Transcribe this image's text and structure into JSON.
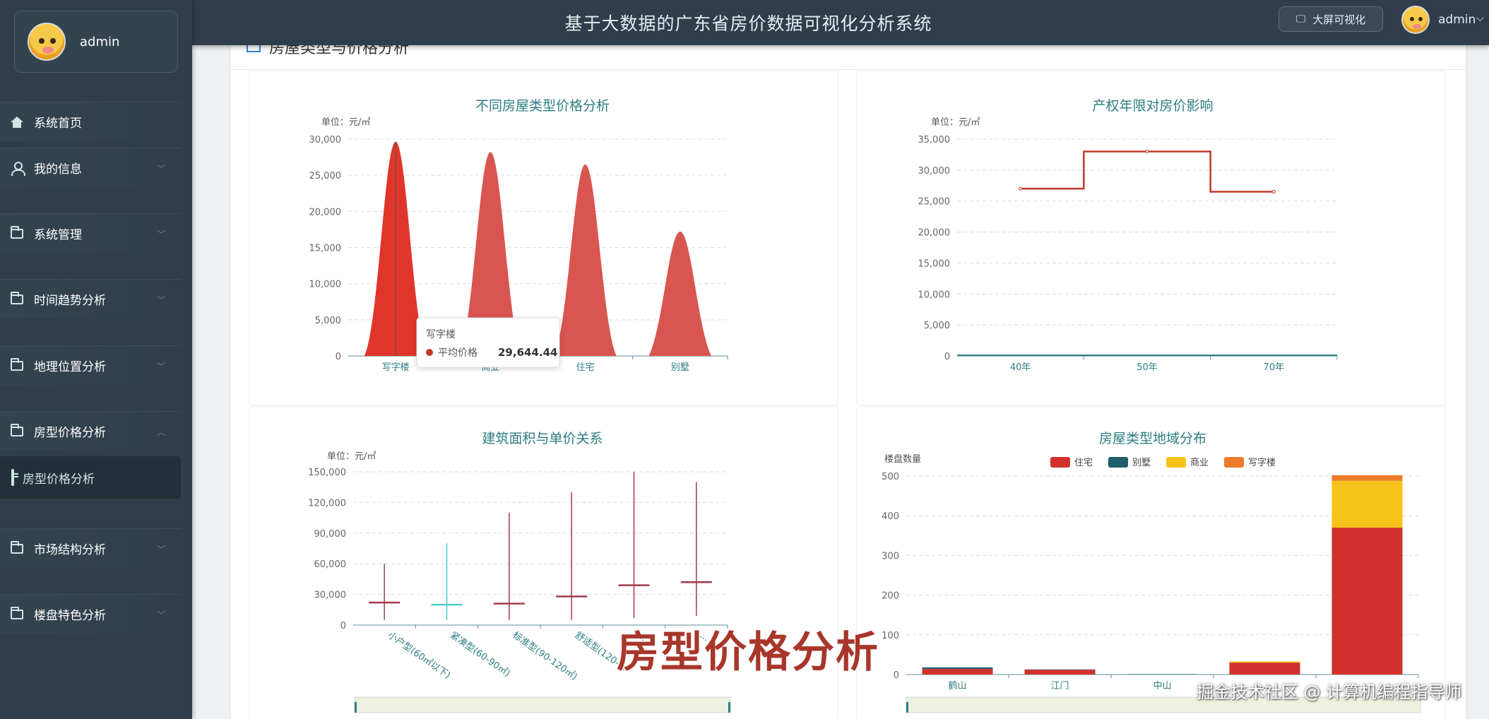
{
  "header": {
    "title": "基于大数据的广东省房价数据可视化分析系统",
    "bigscreen_label": "大屏可视化",
    "username": "admin"
  },
  "sidebar": {
    "username": "admin",
    "items": [
      {
        "label": "系统首页",
        "icon": "home-icon"
      },
      {
        "label": "我的信息",
        "icon": "user-icon"
      },
      {
        "label": "系统管理",
        "icon": "folder-icon"
      },
      {
        "label": "时间趋势分析",
        "icon": "folder-icon"
      },
      {
        "label": "地理位置分析",
        "icon": "folder-icon"
      },
      {
        "label": "房型价格分析",
        "icon": "folder-icon"
      },
      {
        "label": "市场结构分析",
        "icon": "folder-icon"
      },
      {
        "label": "楼盘特色分析",
        "icon": "folder-icon"
      }
    ],
    "active_sub": {
      "label": "房型价格分析",
      "icon": "doc-icon"
    }
  },
  "main": {
    "card_title": "房屋类型与价格分析"
  },
  "watermark": {
    "big": "房型价格分析",
    "small": "掘金技术社区 @ 计算机编程指导师"
  },
  "chart_data": [
    {
      "type": "bar",
      "title": "不同房屋类型价格分析",
      "ylabel": "单位：元/㎡",
      "categories": [
        "写字楼",
        "商业",
        "住宅",
        "别墅"
      ],
      "values": [
        29644.44,
        28200,
        26500,
        17200
      ],
      "ylim": [
        0,
        30000
      ],
      "yticks": [
        "0",
        "5,000",
        "10,000",
        "15,000",
        "20,000",
        "25,000",
        "30,000"
      ],
      "colors": [
        "#e0352b",
        "#d95550",
        "#d95550",
        "#d95550"
      ],
      "tooltip": {
        "title": "写字楼",
        "series": "平均价格",
        "value": "29,644.44"
      }
    },
    {
      "type": "line",
      "title": "产权年限对房价影响",
      "ylabel": "单位：元/㎡",
      "categories": [
        "40年",
        "50年",
        "70年"
      ],
      "values": [
        27000,
        33000,
        26500
      ],
      "ylim": [
        0,
        35000
      ],
      "yticks": [
        "0",
        "5,000",
        "10,000",
        "15,000",
        "20,000",
        "25,000",
        "30,000",
        "35,000"
      ],
      "color": "#c0392b"
    },
    {
      "type": "candlestick",
      "title": "建筑面积与单价关系",
      "ylabel": "单位：元/㎡",
      "categories": [
        "小户型(60㎡以下)",
        "紧凑型(60-90㎡)",
        "标准型(90-120㎡)",
        "舒适型(120-...",
        "...",
        "..."
      ],
      "low": [
        5000,
        5000,
        5000,
        5000,
        7000,
        9000
      ],
      "high": [
        60000,
        80000,
        110000,
        130000,
        150000,
        140000
      ],
      "mid": [
        22000,
        20000,
        21000,
        28000,
        39000,
        42000
      ],
      "ylim": [
        0,
        150000
      ],
      "yticks": [
        "0",
        "30,000",
        "60,000",
        "90,000",
        "120,000",
        "150,000"
      ],
      "colors": [
        "#a23a4a",
        "#4ecdc4",
        "#a23a4a",
        "#a23a4a",
        "#a23a4a",
        "#a23a4a"
      ]
    },
    {
      "type": "bar",
      "stacked": true,
      "title": "房屋类型地域分布",
      "ylabel": "楼盘数量",
      "categories": [
        "鹤山",
        "江门",
        "中山",
        "...",
        ""
      ],
      "series": [
        {
          "name": "住宅",
          "color": "#d0312d",
          "values": [
            14,
            12,
            0,
            30,
            370
          ]
        },
        {
          "name": "别墅",
          "color": "#1f5f6e",
          "values": [
            4,
            1,
            1,
            0,
            0
          ]
        },
        {
          "name": "商业",
          "color": "#f7c31b",
          "values": [
            0,
            0,
            0,
            3,
            118
          ]
        },
        {
          "name": "写字楼",
          "color": "#ec7c2b",
          "values": [
            0,
            0,
            0,
            0,
            14
          ]
        }
      ],
      "ylim": [
        0,
        500
      ],
      "yticks": [
        "0",
        "100",
        "200",
        "300",
        "400",
        "500"
      ]
    }
  ]
}
